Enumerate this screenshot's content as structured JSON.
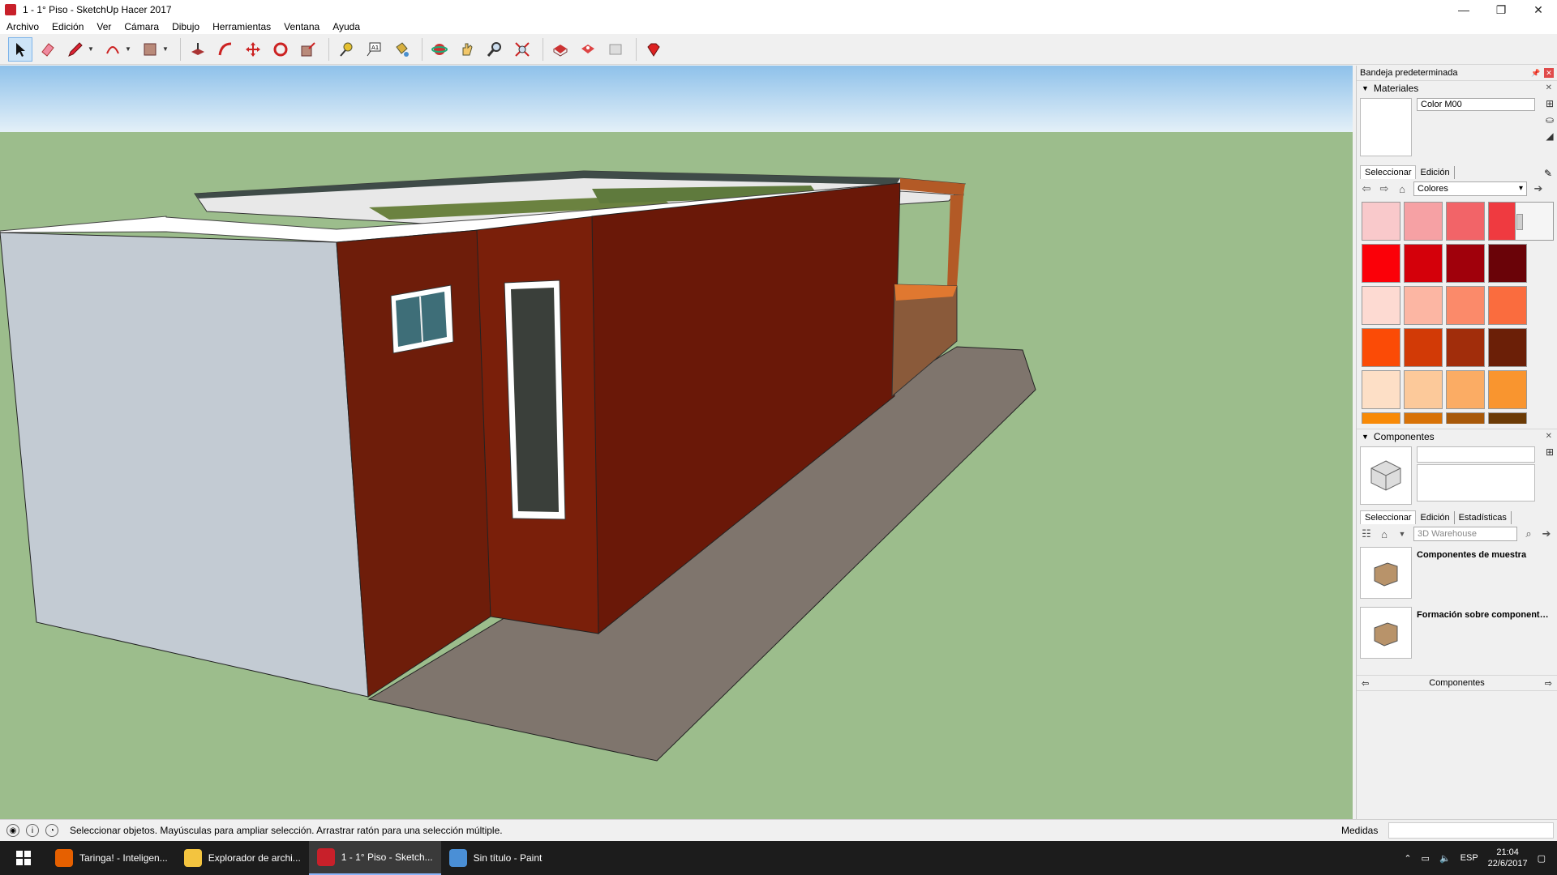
{
  "window": {
    "title": "1 - 1° Piso - SketchUp Hacer 2017",
    "controls": [
      "—",
      "❐",
      "✕"
    ]
  },
  "menu": [
    "Archivo",
    "Edición",
    "Ver",
    "Cámara",
    "Dibujo",
    "Herramientas",
    "Ventana",
    "Ayuda"
  ],
  "toolbar": {
    "tools": [
      "select-icon",
      "eraser-icon",
      "pencil-icon",
      "arc-icon",
      "rectangle-icon",
      "push-pull-icon",
      "follow-me-icon",
      "move-icon",
      "rotate-icon",
      "scale-icon",
      "tape-measure-icon",
      "text-icon",
      "paint-bucket-icon",
      "orbit-icon",
      "pan-icon",
      "zoom-icon",
      "zoom-extents-icon",
      "warehouse-icon",
      "extension-warehouse-icon",
      "layout-icon",
      "ruby-icon"
    ]
  },
  "tray": {
    "title": "Bandeja predeterminada",
    "materials": {
      "heading": "Materiales",
      "name": "Color M00",
      "tab_select": "Seleccionar",
      "tab_edit": "Edición",
      "library": "Colores",
      "swatches": [
        "#f9c9cb",
        "#f6a1a4",
        "#f26468",
        "#ef3a40",
        "#fb0008",
        "#d4000a",
        "#a0000b",
        "#6a0308",
        "#fddad2",
        "#fcb6a3",
        "#fb8a6a",
        "#fa6c3e",
        "#fb4b06",
        "#d23a06",
        "#a12d0b",
        "#6b1f07",
        "#fddfc6",
        "#fcc99a",
        "#fbac64",
        "#f9952f",
        "#f88a07",
        "#d87207",
        "#a8590a",
        "#6c3b06"
      ]
    },
    "components": {
      "heading": "Componentes",
      "tab_select": "Seleccionar",
      "tab_edit": "Edición",
      "tab_stats": "Estadísticas",
      "search_placeholder": "3D Warehouse",
      "items": [
        {
          "label": "Componentes de muestra"
        },
        {
          "label": "Formación sobre component…"
        }
      ],
      "footer": "Componentes"
    }
  },
  "status": {
    "message": "Seleccionar objetos. Mayúsculas para ampliar selección. Arrastrar ratón para una selección múltiple.",
    "measure_label": "Medidas"
  },
  "taskbar": {
    "tasks": [
      {
        "label": "Taringa! - Inteligen...",
        "color": "#e66000"
      },
      {
        "label": "Explorador de archi...",
        "color": "#f3c43f"
      },
      {
        "label": "1 - 1° Piso - Sketch...",
        "color": "#c8202a"
      },
      {
        "label": "Sin título - Paint",
        "color": "#4a8fd6"
      }
    ],
    "lang": "ESP",
    "time": "21:04",
    "date": "22/6/2017"
  }
}
